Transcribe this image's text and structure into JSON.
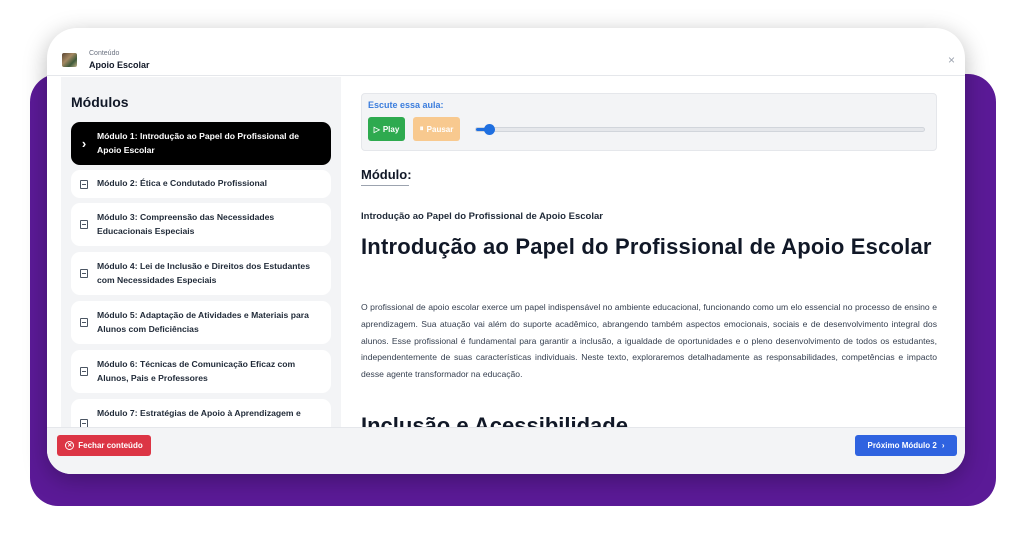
{
  "header": {
    "caption": "Conteúdo",
    "title": "Apoio Escolar",
    "close_icon": "×"
  },
  "sidebar": {
    "title": "Módulos",
    "items": [
      {
        "label": "Módulo 1: Introdução ao Papel do Profissional de Apoio Escolar",
        "active": true
      },
      {
        "label": "Módulo 2: Ética e Condutado Profissional",
        "active": false
      },
      {
        "label": "Módulo 3: Compreensão das Necessidades Educacionais Especiais",
        "active": false
      },
      {
        "label": "Módulo 4: Lei de Inclusão e Direitos dos Estudantes com Necessidades Especiais",
        "active": false
      },
      {
        "label": "Módulo 5: Adaptação de Atividades e Materiais para Alunos com Deficiências",
        "active": false
      },
      {
        "label": "Módulo 6: Técnicas de Comunicação Eficaz com Alunos, Pais e Professores",
        "active": false
      },
      {
        "label": "Módulo 7: Estratégias de Apoio à Aprendizagem e",
        "active": false
      }
    ]
  },
  "audio": {
    "label": "Escute essa aula:",
    "play_label": "Play",
    "pause_label": "Pausar",
    "progress": 0.03
  },
  "content": {
    "module_heading": "Módulo:",
    "subtitle": "Introdução ao Papel do Profissional de Apoio Escolar",
    "title": "Introdução ao Papel do Profissional de Apoio Escolar",
    "paragraph": "O profissional de apoio escolar exerce um papel indispensável no ambiente educacional, funcionando como um elo essencial no processo de ensino e aprendizagem. Sua atuação vai além do suporte acadêmico, abrangendo também aspectos emocionais, sociais e de desenvolvimento integral dos alunos. Esse profissional é fundamental para garantir a inclusão, a igualdade de oportunidades e o pleno desenvolvimento de todos os estudantes, independentemente de suas características individuais. Neste texto, exploraremos detalhadamente as responsabilidades, competências e impacto desse agente transformador na educação.",
    "next_heading": "Inclusão e Acessibilidade"
  },
  "footer": {
    "close_label": "Fechar conteúdo",
    "next_label": "Próximo Módulo 2"
  },
  "colors": {
    "purple_bg": "#5b1a97",
    "play_green": "#2eaa4f",
    "pause_orange": "#f8c98f",
    "close_red": "#dc3545",
    "next_blue": "#2f63e0",
    "accent_blue": "#3b7ddd"
  }
}
